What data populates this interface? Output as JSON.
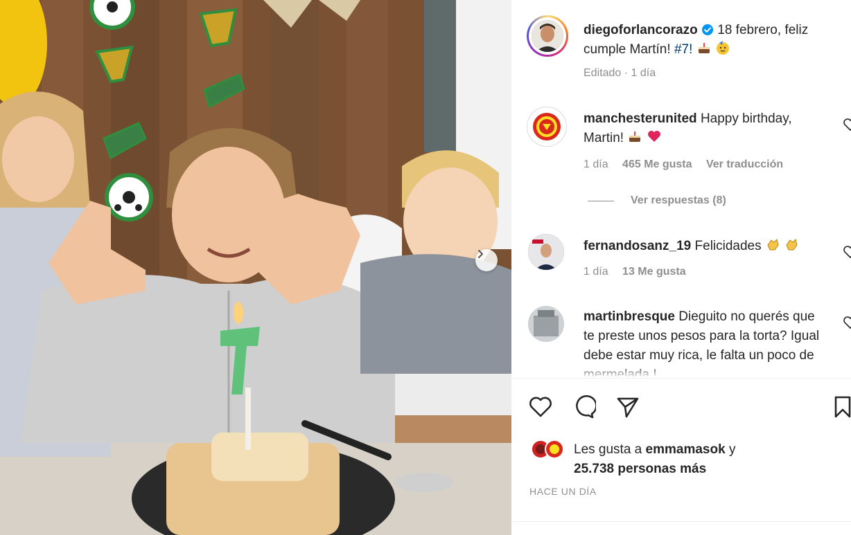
{
  "post": {
    "author": "diegoforlancorazo",
    "caption": "18 febrero, feliz cumple Martín!",
    "hashtag": "#7!",
    "edited": "Editado",
    "edited_sep": "·",
    "edited_time": "1 día"
  },
  "comments": [
    {
      "user": "manchesterunited",
      "text": "Happy birthday, Martin!",
      "time": "1 día",
      "likes": "465 Me gusta",
      "translate": "Ver traducción"
    },
    {
      "user": "fernandosanz_19",
      "text": "Felicidades",
      "time": "1 día",
      "likes": "13 Me gusta"
    },
    {
      "user": "martinbresque",
      "text": "Dieguito no querés que te preste unos pesos para la torta? Igual debe estar muy rica, le falta un poco de mermelada !"
    }
  ],
  "replies": {
    "label": "Ver respuestas (8)"
  },
  "likes_line": {
    "prefix": "Les gusta a",
    "user": "emmamasok",
    "joiner": "y",
    "count": "25.738 personas más"
  },
  "timestamp": "HACE UN DÍA",
  "icons": {
    "like": "heart-outline-icon",
    "comment": "speech-bubble-icon",
    "share": "paper-plane-icon",
    "save": "bookmark-icon",
    "next": "chevron-right-icon",
    "verified": "verified-badge-icon"
  },
  "colors": {
    "link": "#00376b",
    "muted": "#8e8e8e",
    "verified": "#0095f6"
  }
}
